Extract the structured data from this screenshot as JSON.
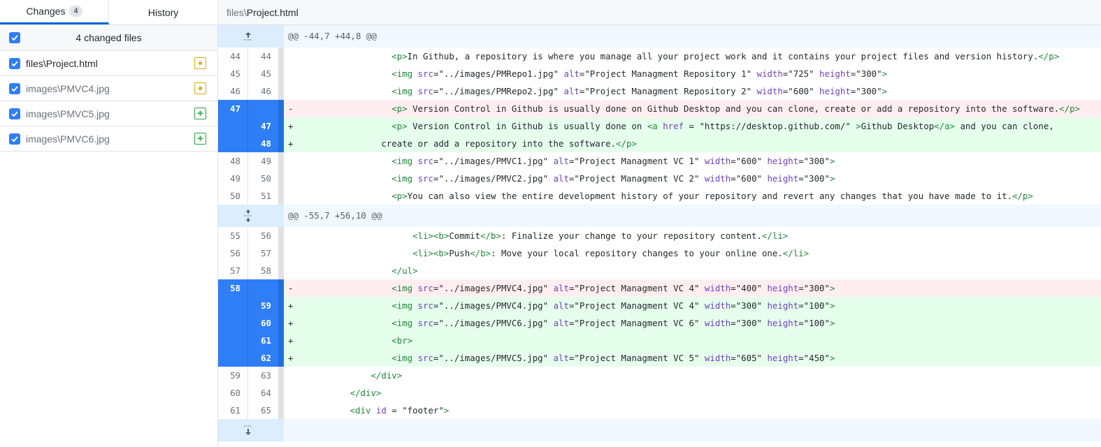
{
  "sidebar": {
    "tabs": [
      {
        "label": "Changes",
        "count": "4",
        "active": true
      },
      {
        "label": "History",
        "active": false
      }
    ],
    "changes_header": {
      "label": "4 changed files",
      "checked": true
    },
    "files": [
      {
        "dir": "files\\",
        "name": "Project.html",
        "status": "modified",
        "checked": true
      },
      {
        "dir": "images\\",
        "name": "PMVC4.jpg",
        "status": "modified",
        "checked": true
      },
      {
        "dir": "images\\",
        "name": "PMVC5.jpg",
        "status": "added",
        "checked": true
      },
      {
        "dir": "images\\",
        "name": "PMVC6.jpg",
        "status": "added",
        "checked": true
      }
    ]
  },
  "diff": {
    "file_dir": "files\\",
    "file_name": "Project.html",
    "colors": {
      "selected": "#2f7ef6",
      "added_bg": "#e6ffed",
      "removed_bg": "#ffeef0",
      "hunk_bg": "#f1f8ff"
    },
    "lines": [
      {
        "type": "hunk",
        "icon": "expand-up-icon",
        "text": "@@ -44,7 +44,8 @@"
      },
      {
        "type": "ctx",
        "old": "44",
        "new": "44",
        "indent": "                  ",
        "html": "<span class=t>&lt;p&gt;</span>In Github, a repository is where you manage all your project work and it contains your project files and version history.<span class=t>&lt;/p&gt;</span>"
      },
      {
        "type": "ctx",
        "old": "45",
        "new": "45",
        "indent": "                  ",
        "html": "<span class=t>&lt;img</span> <span class=a>src</span>=\"../images/PMRepo1.jpg\" <span class=a>alt</span>=\"Project Managment Repository 1\" <span class=a>width</span>=\"725\" <span class=a>height</span>=\"300\"<span class=t>&gt;</span>"
      },
      {
        "type": "ctx",
        "old": "46",
        "new": "46",
        "indent": "                  ",
        "html": "<span class=t>&lt;img</span> <span class=a>src</span>=\"../images/PMRepo2.jpg\" <span class=a>alt</span>=\"Project Managment Repository 2\" <span class=a>width</span>=\"600\" <span class=a>height</span>=\"300\"<span class=t>&gt;</span>"
      },
      {
        "type": "del",
        "old": "47",
        "new": "",
        "sel": true,
        "indent": "                  ",
        "html": "<span class=t>&lt;p&gt;</span> Version Control in Github is usually done on Github Desktop and you can clone, create or add a repository into the software.<span class=t>&lt;/p&gt;</span>"
      },
      {
        "type": "add",
        "old": "",
        "new": "47",
        "sel": true,
        "indent": "                  ",
        "html": "<span class=t>&lt;p&gt;</span> Version Control in Github is usually done on <span class=t>&lt;a</span> <span class=a>href</span> = \"https://desktop.github.com/\" <span class=t>&gt;</span>Github Desktop<span class=t>&lt;/a&gt;</span> and you can clone,"
      },
      {
        "type": "add",
        "old": "",
        "new": "48",
        "sel": true,
        "indent": "                ",
        "html": "create or add a repository into the software.<span class=t>&lt;/p&gt;</span>"
      },
      {
        "type": "ctx",
        "old": "48",
        "new": "49",
        "indent": "                  ",
        "html": "<span class=t>&lt;img</span> <span class=a>src</span>=\"../images/PMVC1.jpg\" <span class=a>alt</span>=\"Project Managment VC 1\" <span class=a>width</span>=\"600\" <span class=a>height</span>=\"300\"<span class=t>&gt;</span>"
      },
      {
        "type": "ctx",
        "old": "49",
        "new": "50",
        "indent": "                  ",
        "html": "<span class=t>&lt;img</span> <span class=a>src</span>=\"../images/PMVC2.jpg\" <span class=a>alt</span>=\"Project Managment VC 2\" <span class=a>width</span>=\"600\" <span class=a>height</span>=\"300\"<span class=t>&gt;</span>"
      },
      {
        "type": "ctx",
        "old": "50",
        "new": "51",
        "indent": "                  ",
        "html": "<span class=t>&lt;p&gt;</span>You can also view the entire development history of your repository and revert any changes that you have made to it.<span class=t>&lt;/p&gt;</span>"
      },
      {
        "type": "hunk",
        "icon": "expand-both-icon",
        "text": "@@ -55,7 +56,10 @@"
      },
      {
        "type": "ctx",
        "old": "55",
        "new": "56",
        "indent": "                      ",
        "html": "<span class=t>&lt;li&gt;&lt;b&gt;</span>Commit<span class=t>&lt;/b&gt;</span>: Finalize your change to your repository content.<span class=t>&lt;/li&gt;</span>"
      },
      {
        "type": "ctx",
        "old": "56",
        "new": "57",
        "indent": "                      ",
        "html": "<span class=t>&lt;li&gt;&lt;b&gt;</span>Push<span class=t>&lt;/b&gt;</span>: Move your local repository changes to your online one.<span class=t>&lt;/li&gt;</span>"
      },
      {
        "type": "ctx",
        "old": "57",
        "new": "58",
        "indent": "                  ",
        "html": "<span class=t>&lt;/ul&gt;</span>"
      },
      {
        "type": "del",
        "old": "58",
        "new": "",
        "sel": true,
        "indent": "                  ",
        "html": "<span class=t>&lt;img</span> <span class=a>src</span>=\"../images/PMVC4.jpg\" <span class=a>alt</span>=\"Project Managment VC 4\" <span class=a>width</span>=\"400\" <span class=a>height</span>=\"300\"<span class=t>&gt;</span>"
      },
      {
        "type": "add",
        "old": "",
        "new": "59",
        "sel": true,
        "indent": "                  ",
        "html": "<span class=t>&lt;img</span> <span class=a>src</span>=\"../images/PMVC4.jpg\" <span class=a>alt</span>=\"Project Managment VC 4\" <span class=a>width</span>=\"300\" <span class=a>height</span>=\"100\"<span class=t>&gt;</span>"
      },
      {
        "type": "add",
        "old": "",
        "new": "60",
        "sel": true,
        "indent": "                  ",
        "html": "<span class=t>&lt;img</span> <span class=a>src</span>=\"../images/PMVC6.jpg\" <span class=a>alt</span>=\"Project Managment VC 6\" <span class=a>width</span>=\"300\" <span class=a>height</span>=\"100\"<span class=t>&gt;</span>"
      },
      {
        "type": "add",
        "old": "",
        "new": "61",
        "sel": true,
        "indent": "                  ",
        "html": "<span class=t>&lt;br&gt;</span>"
      },
      {
        "type": "add",
        "old": "",
        "new": "62",
        "sel": true,
        "indent": "                  ",
        "html": "<span class=t>&lt;img</span> <span class=a>src</span>=\"../images/PMVC5.jpg\" <span class=a>alt</span>=\"Project Managment VC 5\" <span class=a>width</span>=\"605\" <span class=a>height</span>=\"450\"<span class=t>&gt;</span>"
      },
      {
        "type": "ctx",
        "old": "59",
        "new": "63",
        "indent": "              ",
        "html": "<span class=t>&lt;/div&gt;</span>"
      },
      {
        "type": "ctx",
        "old": "60",
        "new": "64",
        "indent": "          ",
        "html": "<span class=t>&lt;/div&gt;</span>"
      },
      {
        "type": "ctx",
        "old": "61",
        "new": "65",
        "indent": "          ",
        "html": "<span class=t>&lt;div</span> <span class=a>id</span> = \"footer\"<span class=t>&gt;</span>"
      },
      {
        "type": "trail",
        "icon": "expand-down-icon"
      }
    ]
  }
}
